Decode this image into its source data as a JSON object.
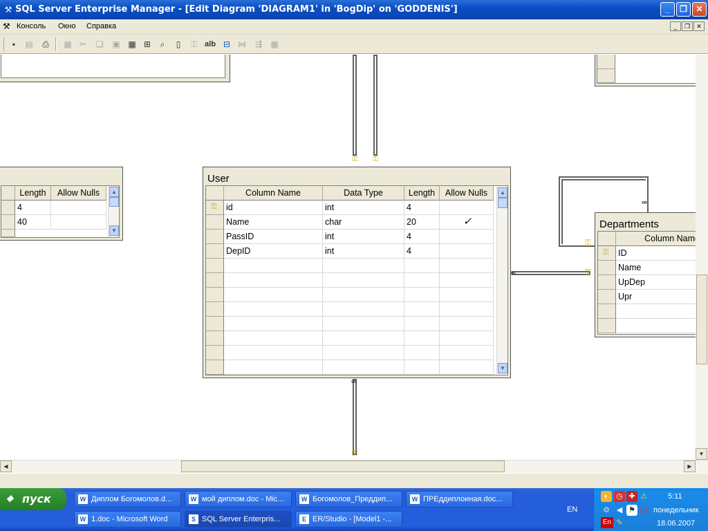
{
  "window": {
    "title": "SQL Server Enterprise Manager - [Edit Diagram 'DIAGRAM1' in 'BogDip' on 'GODDENIS']",
    "icon": "sql-server-icon"
  },
  "menu": {
    "items": [
      "Консоль",
      "Окно",
      "Справка"
    ]
  },
  "toolbar": {
    "icons": [
      "save-icon",
      "properties-icon",
      "print-icon",
      "new-table-icon",
      "cut-icon",
      "copy-icon",
      "paste-icon",
      "add-table-icon",
      "add-related-icon",
      "zoom-icon",
      "script-icon",
      "primary-key-icon",
      "text-annotation-icon",
      "relationship-icon",
      "arrange-icon",
      "layout-icon",
      "grid-icon"
    ],
    "text_button": "alb"
  },
  "left_table": {
    "headers": [
      "Length",
      "Allow Nulls"
    ],
    "rows": [
      [
        "4",
        ""
      ],
      [
        "40",
        ""
      ]
    ]
  },
  "user_table": {
    "name": "User",
    "headers": [
      "Column Name",
      "Data Type",
      "Length",
      "Allow Nulls"
    ],
    "rows": [
      {
        "key": true,
        "name": "id",
        "type": "int",
        "length": "4",
        "nulls": ""
      },
      {
        "key": false,
        "name": "Name",
        "type": "char",
        "length": "20",
        "nulls": "✓"
      },
      {
        "key": false,
        "name": "PassID",
        "type": "int",
        "length": "4",
        "nulls": ""
      },
      {
        "key": false,
        "name": "DepID",
        "type": "int",
        "length": "4",
        "nulls": ""
      }
    ]
  },
  "departments_table": {
    "name": "Departments",
    "headers": [
      "Column Name"
    ],
    "rows": [
      {
        "key": true,
        "name": "ID"
      },
      {
        "key": false,
        "name": "Name"
      },
      {
        "key": false,
        "name": "UpDep"
      },
      {
        "key": false,
        "name": "Upr"
      }
    ]
  },
  "taskbar": {
    "start_label": "пуск",
    "tasks_row1": [
      {
        "label": "Диплом Богомолов.d...",
        "icon": "W"
      },
      {
        "label": "мой диплом.doc - Mic...",
        "icon": "W"
      },
      {
        "label": "Богомолов_Преддип...",
        "icon": "W"
      },
      {
        "label": "ПРЕддиплоиная.doc...",
        "icon": "W"
      }
    ],
    "tasks_row2": [
      {
        "label": "1.doc - Microsoft Word",
        "icon": "W"
      },
      {
        "label": "SQL Server Enterpris...",
        "icon": "S",
        "active": true
      },
      {
        "label": "ER/Studio - [Model1 -...",
        "icon": "E"
      }
    ],
    "language": "EN",
    "time": "5:11",
    "weekday": "понедельник",
    "date": "18.06.2007",
    "tray_lang_badge": "En"
  }
}
